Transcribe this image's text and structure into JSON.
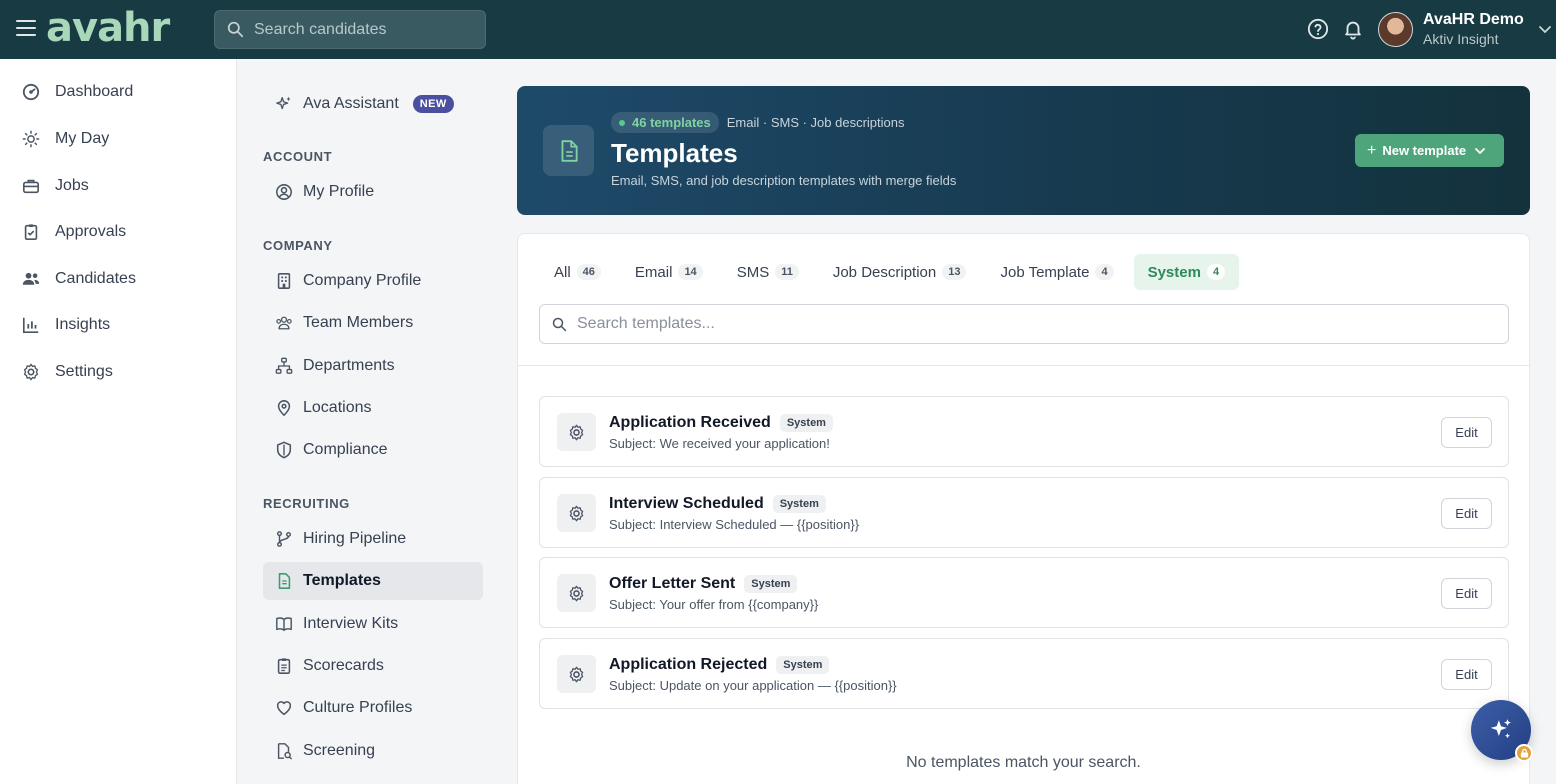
{
  "topbar": {
    "logo": "avahr",
    "search_placeholder": "Search candidates",
    "user_name": "AvaHR Demo",
    "user_org": "Aktiv Insight"
  },
  "leftnav": {
    "items": [
      {
        "label": "Dashboard",
        "icon": "dashboard-icon"
      },
      {
        "label": "My Day",
        "icon": "sun-icon"
      },
      {
        "label": "Jobs",
        "icon": "briefcase-icon"
      },
      {
        "label": "Approvals",
        "icon": "clipboard-check-icon"
      },
      {
        "label": "Candidates",
        "icon": "users-icon"
      },
      {
        "label": "Insights",
        "icon": "bar-chart-icon"
      },
      {
        "label": "Settings",
        "icon": "gear-icon"
      }
    ]
  },
  "subnav": {
    "assistant_label": "Ava Assistant",
    "assistant_badge": "NEW",
    "account_heading": "ACCOUNT",
    "account_items": [
      {
        "label": "My Profile",
        "icon": "user-circle-icon"
      }
    ],
    "company_heading": "COMPANY",
    "company_items": [
      {
        "label": "Company Profile",
        "icon": "building-icon"
      },
      {
        "label": "Team Members",
        "icon": "team-icon"
      },
      {
        "label": "Departments",
        "icon": "org-chart-icon"
      },
      {
        "label": "Locations",
        "icon": "map-pin-icon"
      },
      {
        "label": "Compliance",
        "icon": "shield-icon"
      }
    ],
    "recruiting_heading": "RECRUITING",
    "recruiting_items": [
      {
        "label": "Hiring Pipeline",
        "icon": "git-branch-icon"
      },
      {
        "label": "Templates",
        "icon": "document-icon",
        "active": true
      },
      {
        "label": "Interview Kits",
        "icon": "book-icon"
      },
      {
        "label": "Scorecards",
        "icon": "clipboard-icon"
      },
      {
        "label": "Culture Profiles",
        "icon": "heart-icon"
      },
      {
        "label": "Screening",
        "icon": "file-search-icon"
      }
    ]
  },
  "hero": {
    "count_pill": "46 templates",
    "tags": "Email · SMS · Job descriptions",
    "title": "Templates",
    "subtitle": "Email, SMS, and job description templates with merge fields",
    "new_button": "New template",
    "accent": "#4ea57c"
  },
  "tabs": [
    {
      "label": "All",
      "count": "46"
    },
    {
      "label": "Email",
      "count": "14"
    },
    {
      "label": "SMS",
      "count": "11"
    },
    {
      "label": "Job Description",
      "count": "13"
    },
    {
      "label": "Job Template",
      "count": "4"
    },
    {
      "label": "System",
      "count": "4",
      "active": true
    }
  ],
  "search_templates_placeholder": "Search templates...",
  "templates": [
    {
      "title": "Application Received",
      "badge": "System",
      "subject": "Subject: We received your application!",
      "edit": "Edit"
    },
    {
      "title": "Interview Scheduled",
      "badge": "System",
      "subject": "Subject: Interview Scheduled — {{position}}",
      "edit": "Edit"
    },
    {
      "title": "Offer Letter Sent",
      "badge": "System",
      "subject": "Subject: Your offer from {{company}}",
      "edit": "Edit"
    },
    {
      "title": "Application Rejected",
      "badge": "System",
      "subject": "Subject: Update on your application — {{position}}",
      "edit": "Edit"
    }
  ],
  "empty_message": "No templates match your search."
}
